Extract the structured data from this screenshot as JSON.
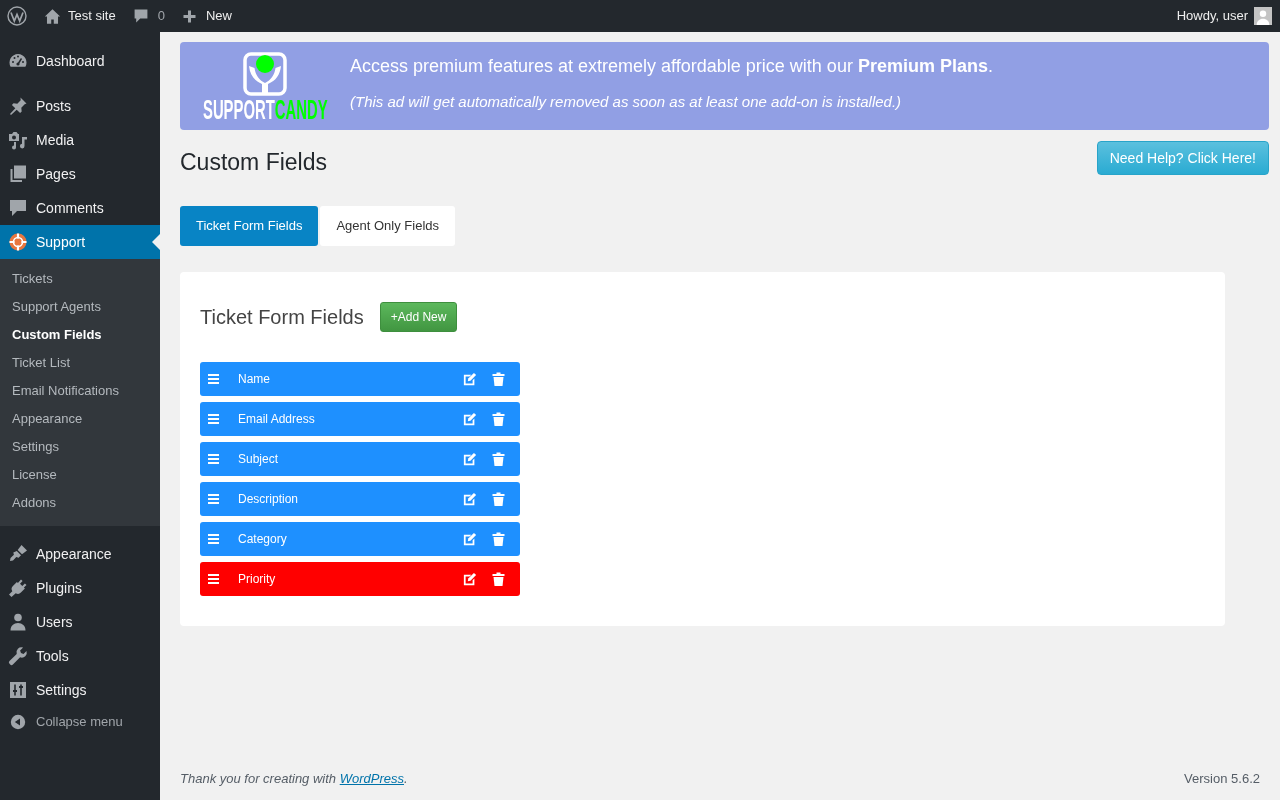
{
  "admin_bar": {
    "site_name": "Test site",
    "comment_count": "0",
    "new_label": "New",
    "greeting": "Howdy, user"
  },
  "sidebar": {
    "groups": [
      {
        "items": [
          {
            "label": "Dashboard",
            "selected": false
          }
        ]
      },
      {
        "items": [
          {
            "label": "Posts",
            "selected": false
          },
          {
            "label": "Media",
            "selected": false
          },
          {
            "label": "Pages",
            "selected": false
          },
          {
            "label": "Comments",
            "selected": false
          },
          {
            "label": "Support",
            "selected": true,
            "submenu": [
              {
                "label": "Tickets",
                "selected": false
              },
              {
                "label": "Support Agents",
                "selected": false
              },
              {
                "label": "Custom Fields",
                "selected": true
              },
              {
                "label": "Ticket List",
                "selected": false
              },
              {
                "label": "Email Notifications",
                "selected": false
              },
              {
                "label": "Appearance",
                "selected": false
              },
              {
                "label": "Settings",
                "selected": false
              },
              {
                "label": "License",
                "selected": false
              },
              {
                "label": "Addons",
                "selected": false
              }
            ]
          }
        ]
      },
      {
        "items": [
          {
            "label": "Appearance",
            "selected": false
          },
          {
            "label": "Plugins",
            "selected": false
          },
          {
            "label": "Users",
            "selected": false
          },
          {
            "label": "Tools",
            "selected": false
          },
          {
            "label": "Settings",
            "selected": false
          }
        ]
      }
    ],
    "collapse_label": "Collapse menu"
  },
  "banner": {
    "brand_light": "SUPPORT",
    "brand_accent": "CANDY",
    "message": "Access premium features at extremely affordable price with our **Premium Plans**.",
    "note": "(This ad will get automatically removed as soon as at least one add-on is installed.)"
  },
  "page_title": "Custom Fields",
  "help_button": "Need Help? Click Here!",
  "tabs": [
    {
      "label": "Ticket Form Fields",
      "selected": true
    },
    {
      "label": "Agent Only Fields",
      "selected": false
    }
  ],
  "panel": {
    "title": "Ticket Form Fields",
    "add_button": "+Add New",
    "fields": [
      {
        "label": "Name",
        "color": "#1e90ff"
      },
      {
        "label": "Email Address",
        "color": "#1e90ff"
      },
      {
        "label": "Subject",
        "color": "#1e90ff"
      },
      {
        "label": "Description",
        "color": "#1e90ff"
      },
      {
        "label": "Category",
        "color": "#1e90ff"
      },
      {
        "label": "Priority",
        "color": "#ff0000"
      }
    ]
  },
  "footer": {
    "text_before": "Thank you for creating with ",
    "link": "WordPress",
    "text_after": ".",
    "version": "Version 5.6.2"
  }
}
